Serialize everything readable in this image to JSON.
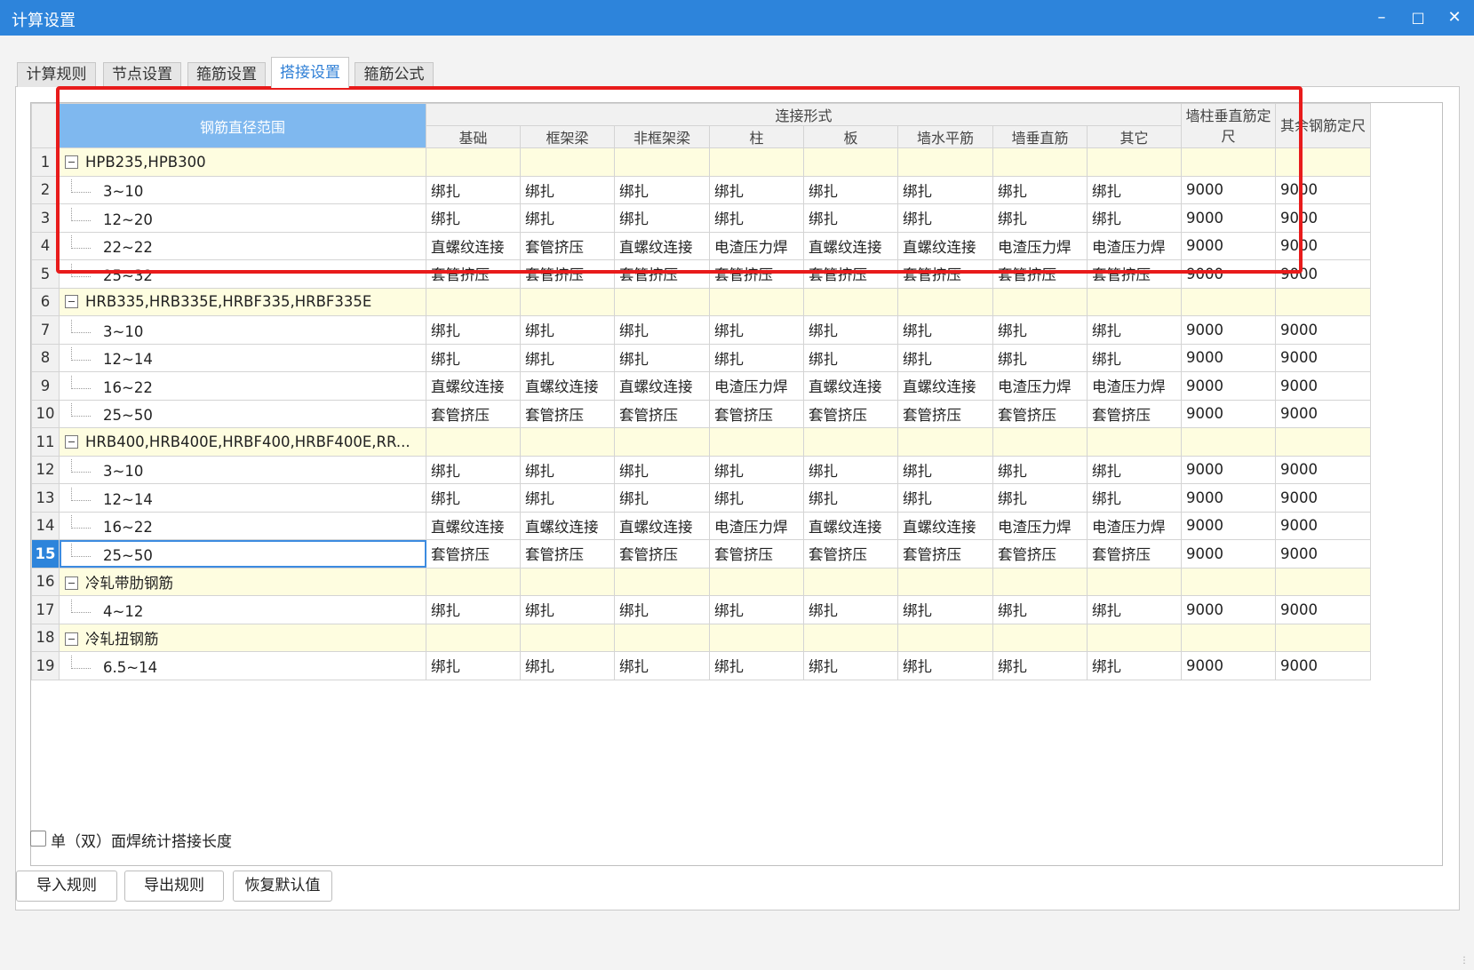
{
  "window": {
    "title": "计算设置",
    "min_icon": "minimize-icon",
    "max_icon": "maximize-icon",
    "close_icon": "close-icon"
  },
  "tabs": [
    {
      "label": "计算规则",
      "active": false
    },
    {
      "label": "节点设置",
      "active": false
    },
    {
      "label": "箍筋设置",
      "active": false
    },
    {
      "label": "搭接设置",
      "active": true
    },
    {
      "label": "箍筋公式",
      "active": false
    }
  ],
  "table": {
    "diameter_header": "钢筋直径范围",
    "group_header": "连接形式",
    "columns": [
      "基础",
      "框架梁",
      "非框架梁",
      "柱",
      "板",
      "墙水平筋",
      "墙垂直筋",
      "其它"
    ],
    "col_extra1": "墙柱垂直筋定尺",
    "col_extra2": "其余钢筋定尺",
    "rows": [
      {
        "num": "1",
        "type": "group",
        "name": "HPB235,HPB300"
      },
      {
        "num": "2",
        "type": "item",
        "name": "3~10",
        "cells": [
          "绑扎",
          "绑扎",
          "绑扎",
          "绑扎",
          "绑扎",
          "绑扎",
          "绑扎",
          "绑扎",
          "9000",
          "9000"
        ]
      },
      {
        "num": "3",
        "type": "item",
        "name": "12~20",
        "cells": [
          "绑扎",
          "绑扎",
          "绑扎",
          "绑扎",
          "绑扎",
          "绑扎",
          "绑扎",
          "绑扎",
          "9000",
          "9000"
        ]
      },
      {
        "num": "4",
        "type": "item",
        "name": "22~22",
        "cells": [
          "直螺纹连接",
          "套管挤压",
          "直螺纹连接",
          "电渣压力焊",
          "直螺纹连接",
          "直螺纹连接",
          "电渣压力焊",
          "电渣压力焊",
          "9000",
          "9000"
        ]
      },
      {
        "num": "5",
        "type": "item",
        "name": "25~32",
        "cells": [
          "套管挤压",
          "套管挤压",
          "套管挤压",
          "套管挤压",
          "套管挤压",
          "套管挤压",
          "套管挤压",
          "套管挤压",
          "9000",
          "9000"
        ]
      },
      {
        "num": "6",
        "type": "group",
        "name": "HRB335,HRB335E,HRBF335,HRBF335E"
      },
      {
        "num": "7",
        "type": "item",
        "name": "3~10",
        "cells": [
          "绑扎",
          "绑扎",
          "绑扎",
          "绑扎",
          "绑扎",
          "绑扎",
          "绑扎",
          "绑扎",
          "9000",
          "9000"
        ]
      },
      {
        "num": "8",
        "type": "item",
        "name": "12~14",
        "cells": [
          "绑扎",
          "绑扎",
          "绑扎",
          "绑扎",
          "绑扎",
          "绑扎",
          "绑扎",
          "绑扎",
          "9000",
          "9000"
        ]
      },
      {
        "num": "9",
        "type": "item",
        "name": "16~22",
        "cells": [
          "直螺纹连接",
          "直螺纹连接",
          "直螺纹连接",
          "电渣压力焊",
          "直螺纹连接",
          "直螺纹连接",
          "电渣压力焊",
          "电渣压力焊",
          "9000",
          "9000"
        ]
      },
      {
        "num": "10",
        "type": "item",
        "name": "25~50",
        "cells": [
          "套管挤压",
          "套管挤压",
          "套管挤压",
          "套管挤压",
          "套管挤压",
          "套管挤压",
          "套管挤压",
          "套管挤压",
          "9000",
          "9000"
        ]
      },
      {
        "num": "11",
        "type": "group",
        "name": "HRB400,HRB400E,HRBF400,HRBF400E,RR..."
      },
      {
        "num": "12",
        "type": "item",
        "name": "3~10",
        "cells": [
          "绑扎",
          "绑扎",
          "绑扎",
          "绑扎",
          "绑扎",
          "绑扎",
          "绑扎",
          "绑扎",
          "9000",
          "9000"
        ]
      },
      {
        "num": "13",
        "type": "item",
        "name": "12~14",
        "cells": [
          "绑扎",
          "绑扎",
          "绑扎",
          "绑扎",
          "绑扎",
          "绑扎",
          "绑扎",
          "绑扎",
          "9000",
          "9000"
        ]
      },
      {
        "num": "14",
        "type": "item",
        "name": "16~22",
        "cells": [
          "直螺纹连接",
          "直螺纹连接",
          "直螺纹连接",
          "电渣压力焊",
          "直螺纹连接",
          "直螺纹连接",
          "电渣压力焊",
          "电渣压力焊",
          "9000",
          "9000"
        ]
      },
      {
        "num": "15",
        "type": "item",
        "name": "25~50",
        "selected": true,
        "cells": [
          "套管挤压",
          "套管挤压",
          "套管挤压",
          "套管挤压",
          "套管挤压",
          "套管挤压",
          "套管挤压",
          "套管挤压",
          "9000",
          "9000"
        ]
      },
      {
        "num": "16",
        "type": "group",
        "name": "冷轧带肋钢筋"
      },
      {
        "num": "17",
        "type": "item",
        "name": "4~12",
        "cells": [
          "绑扎",
          "绑扎",
          "绑扎",
          "绑扎",
          "绑扎",
          "绑扎",
          "绑扎",
          "绑扎",
          "9000",
          "9000"
        ]
      },
      {
        "num": "18",
        "type": "group",
        "name": "冷轧扭钢筋"
      },
      {
        "num": "19",
        "type": "item",
        "name": "6.5~14",
        "cells": [
          "绑扎",
          "绑扎",
          "绑扎",
          "绑扎",
          "绑扎",
          "绑扎",
          "绑扎",
          "绑扎",
          "9000",
          "9000"
        ]
      }
    ]
  },
  "checkbox": {
    "label": "单（双）面焊统计搭接长度",
    "checked": false
  },
  "buttons": {
    "import": "导入规则",
    "export": "导出规则",
    "restore": "恢复默认值"
  }
}
